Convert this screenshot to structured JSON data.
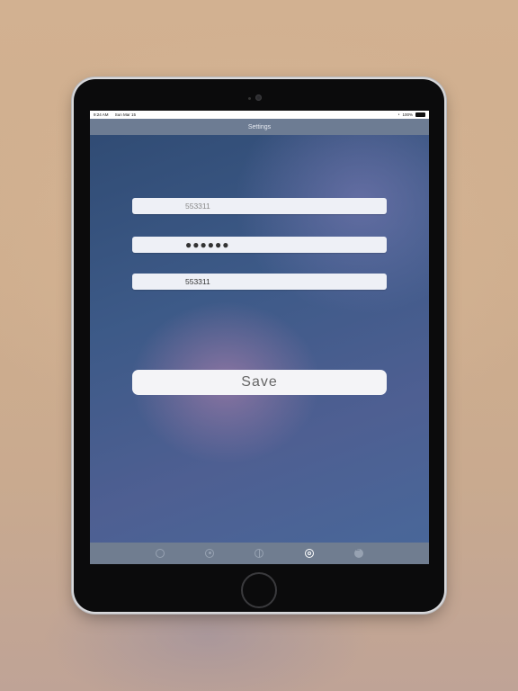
{
  "status_bar": {
    "time": "9:24 AM",
    "date": "Sun Mar 15",
    "battery": "100%"
  },
  "nav": {
    "title": "Settings"
  },
  "form": {
    "field1": {
      "placeholder": "553311"
    },
    "field2": {
      "value": "●●●●●●"
    },
    "field3": {
      "value": "553311"
    },
    "save_label": "Save"
  },
  "tab_bar": {
    "items": [
      {
        "icon": "camera-icon",
        "active": false
      },
      {
        "icon": "person-icon",
        "active": false
      },
      {
        "icon": "globe-icon",
        "active": false
      },
      {
        "icon": "settings-target-icon",
        "active": true
      },
      {
        "icon": "more-icon",
        "active": false
      }
    ]
  },
  "colors": {
    "nav_bar": "#6d7c93",
    "tab_bar": "#707d90",
    "field_bg": "#eef0f6",
    "screen_bg": "#3d5a88"
  }
}
